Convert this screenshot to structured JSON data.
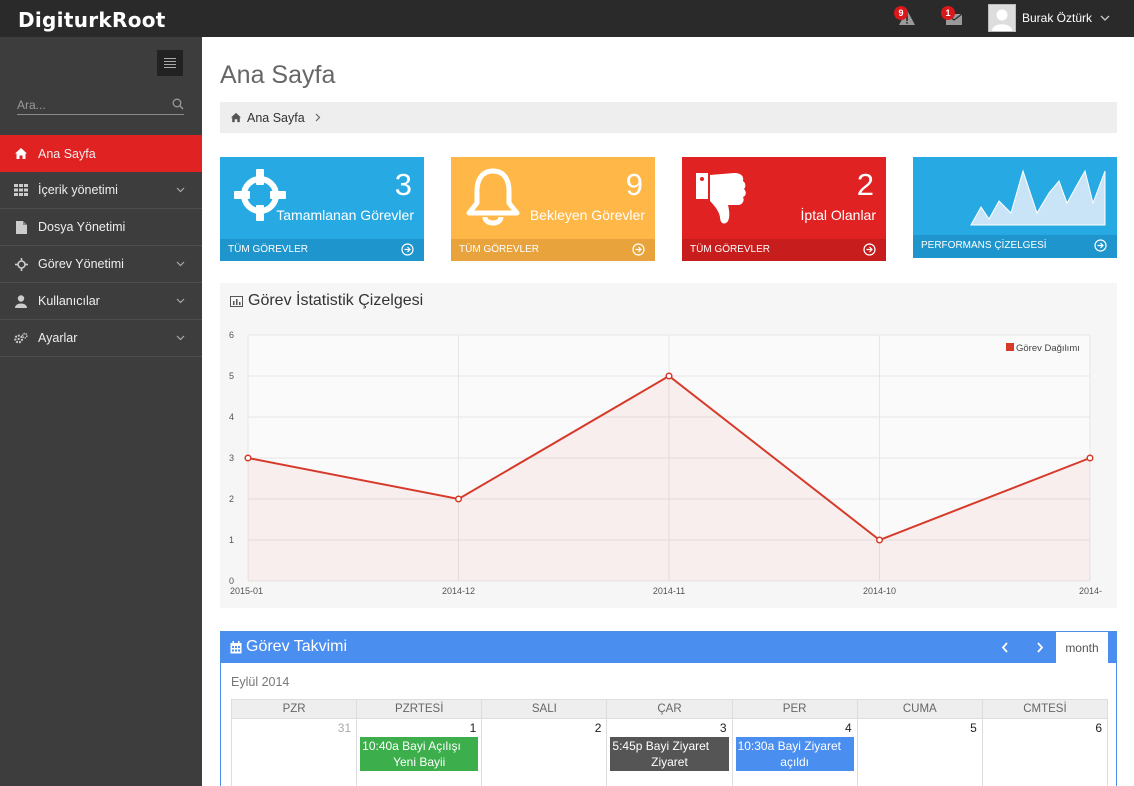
{
  "header": {
    "logo_bold": "DigiturkRoot",
    "alerts_count": "9",
    "messages_count": "1",
    "user_name": "Burak Öztürk"
  },
  "sidebar": {
    "search_placeholder": "Ara...",
    "items": [
      {
        "label": "Ana Sayfa",
        "icon": "home-icon"
      },
      {
        "label": "İçerik yönetimi",
        "icon": "grid-icon"
      },
      {
        "label": "Dosya Yönetimi",
        "icon": "file-icon"
      },
      {
        "label": "Görev Yönetimi",
        "icon": "crosshair-icon"
      },
      {
        "label": "Kullanıcılar",
        "icon": "user-icon"
      },
      {
        "label": "Ayarlar",
        "icon": "cogs-icon"
      }
    ]
  },
  "page": {
    "title": "Ana Sayfa",
    "breadcrumb": "Ana Sayfa"
  },
  "stats": [
    {
      "value": "3",
      "label": "Tamamlanan Görevler",
      "link": "TÜM GÖREVLER",
      "color": "#27a9e3"
    },
    {
      "value": "9",
      "label": "Bekleyen Görevler",
      "link": "TÜM GÖREVLER",
      "color": "#ffb848"
    },
    {
      "value": "2",
      "label": "İptal Olanlar",
      "link": "TÜM GÖREVLER",
      "color": "#e02222"
    },
    {
      "value": "",
      "label": "",
      "link": "PERFORMANS ÇİZELGESİ",
      "color": "#27a9e3"
    }
  ],
  "chart_panel": {
    "title": "Görev İstatistik Çizelgesi"
  },
  "chart_data": {
    "type": "line",
    "categories": [
      "2015-01",
      "2014-12",
      "2014-11",
      "2014-10",
      "2014-"
    ],
    "series": [
      {
        "name": "Görev Dağılımı",
        "values": [
          3,
          2,
          5,
          1,
          3
        ],
        "color": "#d63a2a"
      }
    ],
    "ylim": [
      0,
      6
    ],
    "yticks": [
      "0",
      "1",
      "2",
      "3",
      "4",
      "5",
      "6"
    ],
    "grid": true,
    "legend": "top-right"
  },
  "calendar": {
    "title": "Görev Takvimi",
    "view_button": "month",
    "period": "Eylül 2014",
    "days": [
      "PZR",
      "PZRTESİ",
      "SALI",
      "ÇAR",
      "PER",
      "CUMA",
      "CMTESİ"
    ],
    "dates": [
      "31",
      "1",
      "2",
      "3",
      "4",
      "5",
      "6"
    ],
    "events": [
      {
        "day": 1,
        "line1": "10:40a Bayi Açılışı",
        "line2": "Yeni Bayii",
        "color": "#3cae4b"
      },
      {
        "day": 3,
        "line1": "5:45p Bayi Ziyaret",
        "line2": "Ziyaret",
        "color": "#555555"
      },
      {
        "day": 4,
        "line1": "10:30a Bayi Ziyaret",
        "line2": "açıldı",
        "color": "#4a8ef0"
      }
    ]
  }
}
